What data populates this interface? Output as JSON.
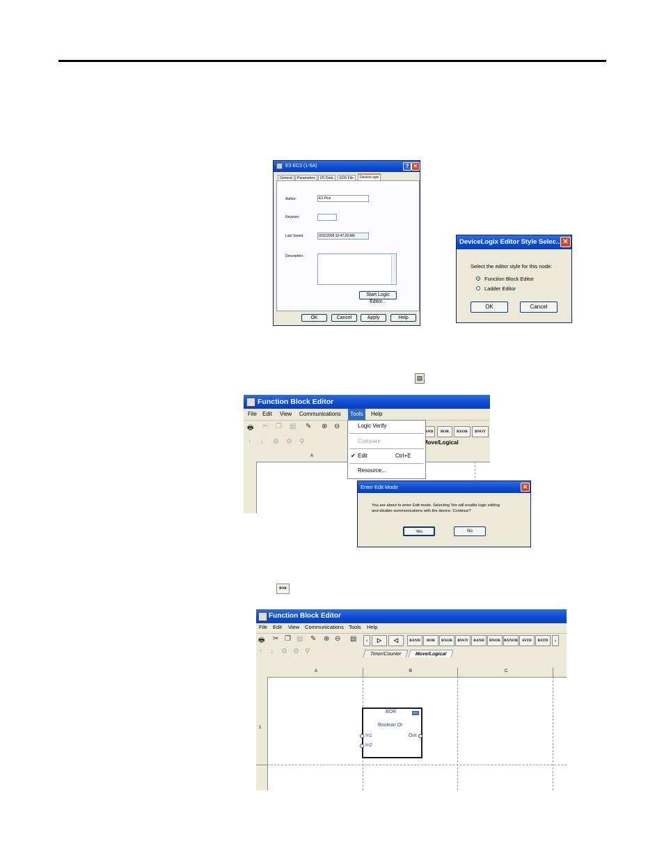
{
  "dialog_props": {
    "title": "E3 EC3 (1-5A)",
    "tabs": [
      "General",
      "Parameters",
      "I/O Data",
      "EDS File",
      "DeviceLogix"
    ],
    "author_label": "Author:",
    "author_value": "E3 Plus",
    "revision_label": "Revision:",
    "revision_value": "",
    "last_saved_label": "Last Saved:",
    "last_saved_value": "3/31/2008 10:47:26 AM",
    "description_label": "Description:",
    "description_value": "",
    "start_button": "Start Logic Editor...",
    "buttons": [
      "OK",
      "Cancel",
      "Apply",
      "Help"
    ]
  },
  "dialog_style": {
    "title": "DeviceLogix Editor Style Selec...",
    "prompt": "Select the editor style for this node:",
    "options": [
      {
        "label": "Function Block Editor",
        "selected": true
      },
      {
        "label": "Ladder Editor",
        "selected": false
      }
    ],
    "ok": "OK",
    "cancel": "Cancel"
  },
  "editor1": {
    "title": "Function Block Editor",
    "menu": [
      "File",
      "Edit",
      "View",
      "Communications",
      "Tools",
      "Help"
    ],
    "toolbar_bool": [
      "AND",
      "BOR",
      "BXOR",
      "BNOT"
    ],
    "tab_active": "Move/Logical",
    "column_a": "A",
    "tools_menu": [
      {
        "label": "Logic Verify",
        "shortcut": "",
        "disabled": false,
        "checked": false
      },
      {
        "label": "Compare",
        "shortcut": "",
        "disabled": true,
        "checked": false
      },
      {
        "label": "Edit",
        "shortcut": "Ctrl+E",
        "disabled": false,
        "checked": true
      },
      {
        "label": "Resource...",
        "shortcut": "",
        "disabled": false,
        "checked": false
      }
    ]
  },
  "edit_mode": {
    "title": "Enter Edit Mode",
    "message_line1": "You are about to enter Edit mode. Selecting Yes will enable logic editing",
    "message_line2": "and disable communications with the device.  Continue?",
    "yes": "Yes",
    "no": "No"
  },
  "bor_icon": "BOR",
  "editor2": {
    "title": "Function Block Editor",
    "menu": [
      "File",
      "Edit",
      "View",
      "Communications",
      "Tools",
      "Help"
    ],
    "toolbar_bool": [
      "BAND",
      "BOR",
      "BXOR",
      "BNOT",
      "BAND",
      "BNOR",
      "BXNOR",
      "SSTD",
      "RSTD"
    ],
    "tabs": [
      "Timer/Counter",
      "Move/Logical"
    ],
    "columns": [
      "A",
      "B",
      "C"
    ],
    "row_label": "1",
    "block": {
      "name": "BOR",
      "badge": "001",
      "desc": "Boolean Or",
      "in1": "In1",
      "in2": "In2",
      "out": "Out"
    }
  },
  "colors": {
    "title_blue": "#0b4ad0",
    "dialog_bg": "#ece9d8",
    "close_red": "#d9421c",
    "block_text": "#1d3fb0"
  },
  "icons": [
    "window-app-icon",
    "help-icon",
    "close-icon",
    "print-icon",
    "cut-icon",
    "copy-icon",
    "paste-icon",
    "zoom-in-icon",
    "zoom-out-icon",
    "check-icon",
    "chevron-left-icon",
    "chevron-right-icon",
    "edit-mode-icon"
  ]
}
